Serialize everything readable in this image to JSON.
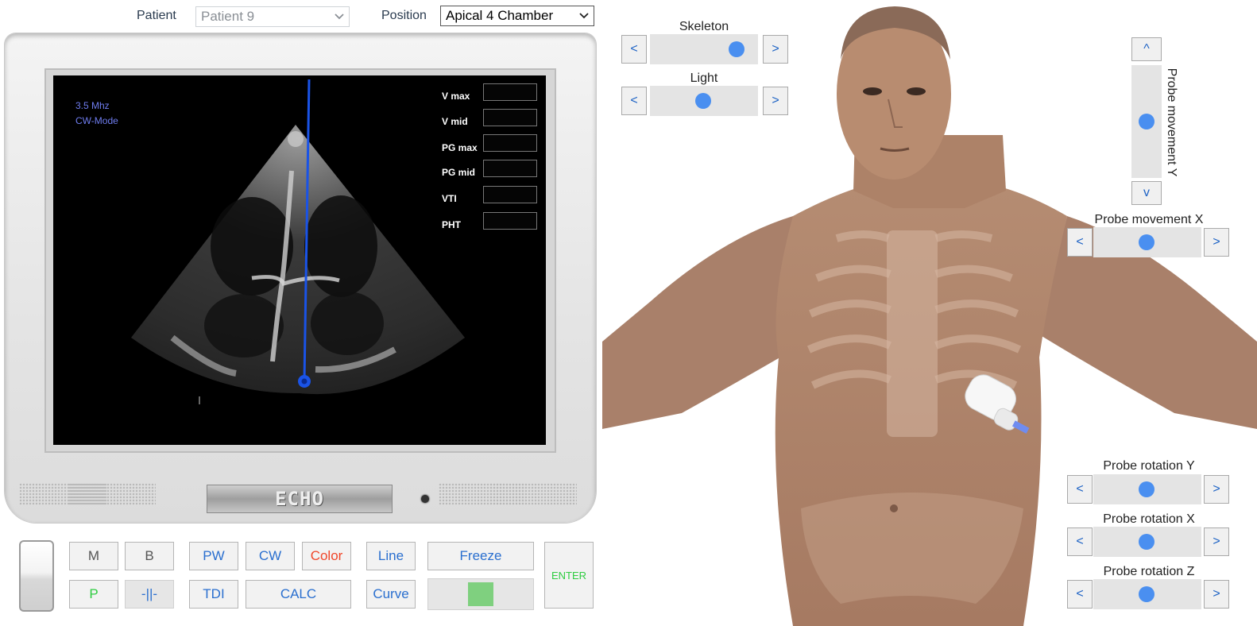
{
  "header": {
    "patient_label": "Patient",
    "patient_value": "Patient 9",
    "position_label": "Position",
    "position_value": "Apical 4 Chamber"
  },
  "monitor": {
    "frequency": "3.5 Mhz",
    "mode": "CW-Mode",
    "brand": "ECHO",
    "measurements": [
      {
        "label": "V max",
        "value": ""
      },
      {
        "label": "V mid",
        "value": ""
      },
      {
        "label": "PG max",
        "value": ""
      },
      {
        "label": "PG mid",
        "value": ""
      },
      {
        "label": "VTI",
        "value": ""
      },
      {
        "label": "PHT",
        "value": ""
      }
    ],
    "colors": {
      "cursor_line": "#1a53e6",
      "mode_text": "#6f7df0"
    }
  },
  "keys": {
    "m": "M",
    "b": "B",
    "p": "P",
    "split": "-||-",
    "pw": "PW",
    "cw": "CW",
    "color": "Color",
    "tdi": "TDI",
    "calc": "CALC",
    "line": "Line",
    "curve": "Curve",
    "freeze": "Freeze",
    "enter": "ENTER"
  },
  "controls": {
    "skeleton": {
      "label": "Skeleton",
      "left": "<",
      "right": ">",
      "value": 0.9
    },
    "light": {
      "label": "Light",
      "left": "<",
      "right": ">",
      "value": 0.5
    },
    "probe_movement_y": {
      "label": "Probe movement Y",
      "up": "^",
      "down": "v",
      "value": 0.5
    },
    "probe_movement_x": {
      "label": "Probe movement X",
      "left": "<",
      "right": ">",
      "value": 0.5
    },
    "probe_rotation_y": {
      "label": "Probe rotation Y",
      "left": "<",
      "right": ">",
      "value": 0.5
    },
    "probe_rotation_x": {
      "label": "Probe rotation X",
      "left": "<",
      "right": ">",
      "value": 0.5
    },
    "probe_rotation_z": {
      "label": "Probe rotation Z",
      "left": "<",
      "right": ">",
      "value": 0.5
    }
  },
  "colors": {
    "accent": "#4a8ff0",
    "button_text": "#1e63c5",
    "freeze_indicator": "#7fd07f"
  }
}
